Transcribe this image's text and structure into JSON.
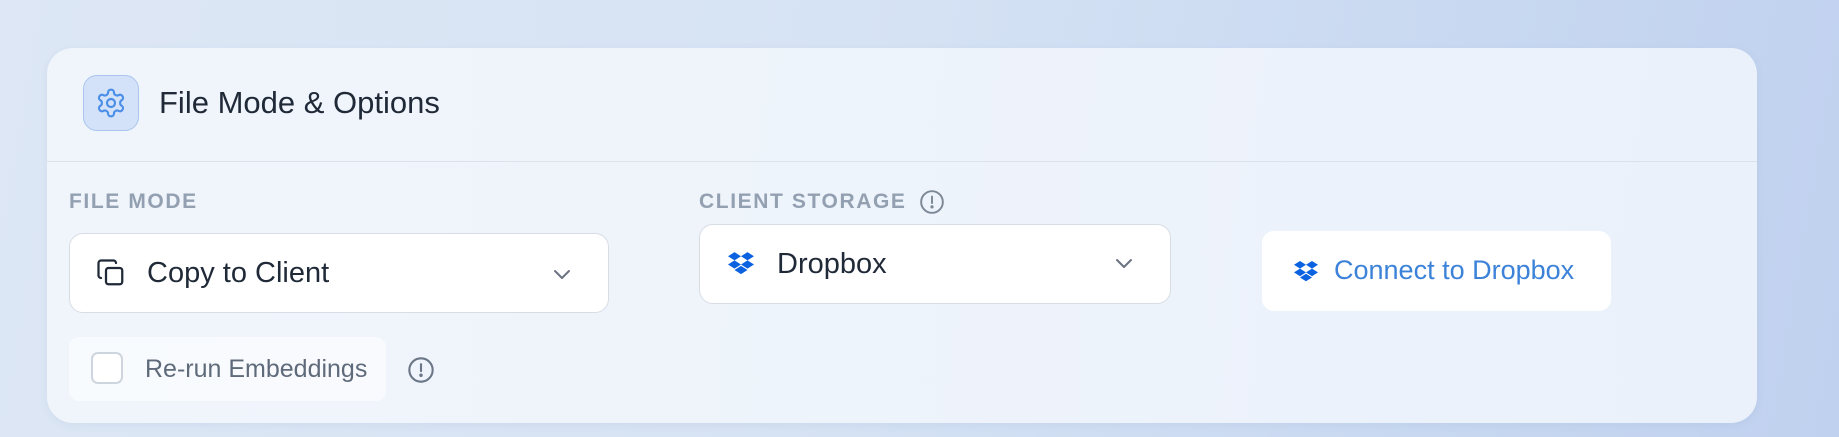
{
  "panel": {
    "title": "File Mode & Options",
    "icon": "gear-icon"
  },
  "file_mode": {
    "label": "FILE MODE",
    "selected": "Copy to Client",
    "icon": "copy-icon"
  },
  "client_storage": {
    "label": "CLIENT STORAGE",
    "selected": "Dropbox",
    "icon": "dropbox-icon",
    "info_icon": "info-icon"
  },
  "connect_button": {
    "label": "Connect to Dropbox",
    "icon": "dropbox-icon"
  },
  "rerun_embeddings": {
    "label": "Re-run Embeddings",
    "checked": false,
    "info_icon": "info-icon"
  },
  "colors": {
    "accent": "#3b82d8",
    "dropbox_blue": "#0b62e0",
    "text_primary": "#1f2937",
    "label_muted": "#93a0b1"
  }
}
